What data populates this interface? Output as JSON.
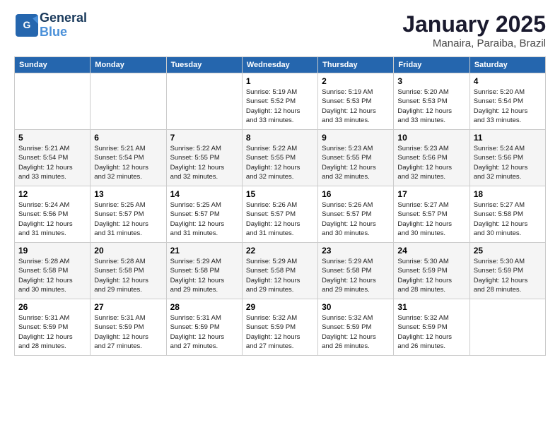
{
  "header": {
    "logo": {
      "line1": "General",
      "line2": "Blue"
    },
    "title": "January 2025",
    "subtitle": "Manaira, Paraiba, Brazil"
  },
  "weekdays": [
    "Sunday",
    "Monday",
    "Tuesday",
    "Wednesday",
    "Thursday",
    "Friday",
    "Saturday"
  ],
  "weeks": [
    [
      {
        "day": "",
        "info": ""
      },
      {
        "day": "",
        "info": ""
      },
      {
        "day": "",
        "info": ""
      },
      {
        "day": "1",
        "info": "Sunrise: 5:19 AM\nSunset: 5:52 PM\nDaylight: 12 hours\nand 33 minutes."
      },
      {
        "day": "2",
        "info": "Sunrise: 5:19 AM\nSunset: 5:53 PM\nDaylight: 12 hours\nand 33 minutes."
      },
      {
        "day": "3",
        "info": "Sunrise: 5:20 AM\nSunset: 5:53 PM\nDaylight: 12 hours\nand 33 minutes."
      },
      {
        "day": "4",
        "info": "Sunrise: 5:20 AM\nSunset: 5:54 PM\nDaylight: 12 hours\nand 33 minutes."
      }
    ],
    [
      {
        "day": "5",
        "info": "Sunrise: 5:21 AM\nSunset: 5:54 PM\nDaylight: 12 hours\nand 33 minutes."
      },
      {
        "day": "6",
        "info": "Sunrise: 5:21 AM\nSunset: 5:54 PM\nDaylight: 12 hours\nand 32 minutes."
      },
      {
        "day": "7",
        "info": "Sunrise: 5:22 AM\nSunset: 5:55 PM\nDaylight: 12 hours\nand 32 minutes."
      },
      {
        "day": "8",
        "info": "Sunrise: 5:22 AM\nSunset: 5:55 PM\nDaylight: 12 hours\nand 32 minutes."
      },
      {
        "day": "9",
        "info": "Sunrise: 5:23 AM\nSunset: 5:55 PM\nDaylight: 12 hours\nand 32 minutes."
      },
      {
        "day": "10",
        "info": "Sunrise: 5:23 AM\nSunset: 5:56 PM\nDaylight: 12 hours\nand 32 minutes."
      },
      {
        "day": "11",
        "info": "Sunrise: 5:24 AM\nSunset: 5:56 PM\nDaylight: 12 hours\nand 32 minutes."
      }
    ],
    [
      {
        "day": "12",
        "info": "Sunrise: 5:24 AM\nSunset: 5:56 PM\nDaylight: 12 hours\nand 31 minutes."
      },
      {
        "day": "13",
        "info": "Sunrise: 5:25 AM\nSunset: 5:57 PM\nDaylight: 12 hours\nand 31 minutes."
      },
      {
        "day": "14",
        "info": "Sunrise: 5:25 AM\nSunset: 5:57 PM\nDaylight: 12 hours\nand 31 minutes."
      },
      {
        "day": "15",
        "info": "Sunrise: 5:26 AM\nSunset: 5:57 PM\nDaylight: 12 hours\nand 31 minutes."
      },
      {
        "day": "16",
        "info": "Sunrise: 5:26 AM\nSunset: 5:57 PM\nDaylight: 12 hours\nand 30 minutes."
      },
      {
        "day": "17",
        "info": "Sunrise: 5:27 AM\nSunset: 5:57 PM\nDaylight: 12 hours\nand 30 minutes."
      },
      {
        "day": "18",
        "info": "Sunrise: 5:27 AM\nSunset: 5:58 PM\nDaylight: 12 hours\nand 30 minutes."
      }
    ],
    [
      {
        "day": "19",
        "info": "Sunrise: 5:28 AM\nSunset: 5:58 PM\nDaylight: 12 hours\nand 30 minutes."
      },
      {
        "day": "20",
        "info": "Sunrise: 5:28 AM\nSunset: 5:58 PM\nDaylight: 12 hours\nand 29 minutes."
      },
      {
        "day": "21",
        "info": "Sunrise: 5:29 AM\nSunset: 5:58 PM\nDaylight: 12 hours\nand 29 minutes."
      },
      {
        "day": "22",
        "info": "Sunrise: 5:29 AM\nSunset: 5:58 PM\nDaylight: 12 hours\nand 29 minutes."
      },
      {
        "day": "23",
        "info": "Sunrise: 5:29 AM\nSunset: 5:58 PM\nDaylight: 12 hours\nand 29 minutes."
      },
      {
        "day": "24",
        "info": "Sunrise: 5:30 AM\nSunset: 5:59 PM\nDaylight: 12 hours\nand 28 minutes."
      },
      {
        "day": "25",
        "info": "Sunrise: 5:30 AM\nSunset: 5:59 PM\nDaylight: 12 hours\nand 28 minutes."
      }
    ],
    [
      {
        "day": "26",
        "info": "Sunrise: 5:31 AM\nSunset: 5:59 PM\nDaylight: 12 hours\nand 28 minutes."
      },
      {
        "day": "27",
        "info": "Sunrise: 5:31 AM\nSunset: 5:59 PM\nDaylight: 12 hours\nand 27 minutes."
      },
      {
        "day": "28",
        "info": "Sunrise: 5:31 AM\nSunset: 5:59 PM\nDaylight: 12 hours\nand 27 minutes."
      },
      {
        "day": "29",
        "info": "Sunrise: 5:32 AM\nSunset: 5:59 PM\nDaylight: 12 hours\nand 27 minutes."
      },
      {
        "day": "30",
        "info": "Sunrise: 5:32 AM\nSunset: 5:59 PM\nDaylight: 12 hours\nand 26 minutes."
      },
      {
        "day": "31",
        "info": "Sunrise: 5:32 AM\nSunset: 5:59 PM\nDaylight: 12 hours\nand 26 minutes."
      },
      {
        "day": "",
        "info": ""
      }
    ]
  ]
}
